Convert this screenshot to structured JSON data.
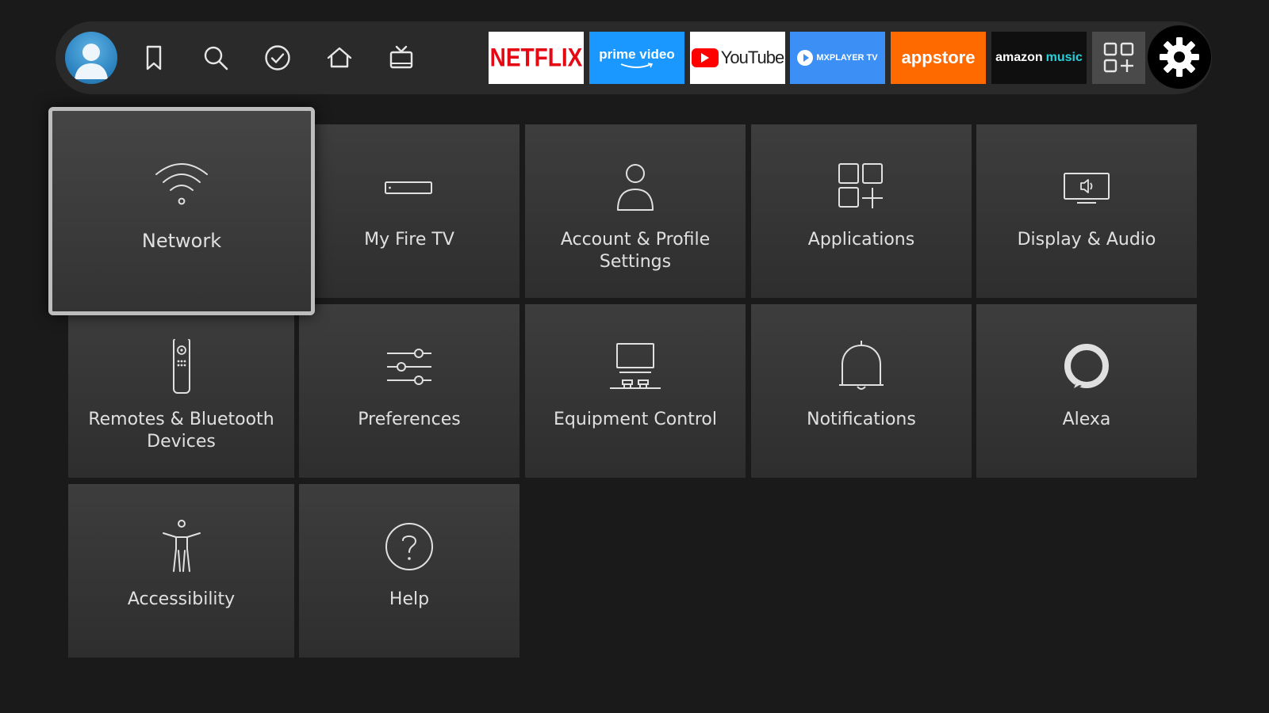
{
  "navbar": {
    "apps": [
      {
        "id": "netflix",
        "label": "NETFLIX",
        "color": "#e50914"
      },
      {
        "id": "prime",
        "label": "prime video",
        "color": "#1a98ff"
      },
      {
        "id": "youtube",
        "label": "YouTube",
        "color": "#ff0000"
      },
      {
        "id": "mx",
        "label": "MXPLAYER TV",
        "color": "#3b8ff5"
      },
      {
        "id": "appstore",
        "label": "appstore",
        "color": "#ff6a00"
      },
      {
        "id": "music",
        "label_brand": "amazon",
        "label_product": "music",
        "color": "#25d1da"
      }
    ],
    "icons": [
      "profile-avatar",
      "bookmark-icon",
      "search-icon",
      "check-circle-icon",
      "home-icon",
      "live-tv-icon",
      "all-apps-icon",
      "settings-gear-icon"
    ]
  },
  "settings": {
    "focused": "Network",
    "tiles": [
      {
        "label": "Network",
        "icon": "wifi-icon"
      },
      {
        "label": "My Fire TV",
        "icon": "fire-tv-device-icon"
      },
      {
        "label": "Account & Profile Settings",
        "icon": "person-icon"
      },
      {
        "label": "Applications",
        "icon": "apps-grid-icon"
      },
      {
        "label": "Display & Audio",
        "icon": "display-audio-icon"
      },
      {
        "label": "Remotes & Bluetooth Devices",
        "icon": "remote-icon"
      },
      {
        "label": "Preferences",
        "icon": "sliders-icon"
      },
      {
        "label": "Equipment Control",
        "icon": "equipment-icon"
      },
      {
        "label": "Notifications",
        "icon": "bell-icon"
      },
      {
        "label": "Alexa",
        "icon": "alexa-ring-icon"
      },
      {
        "label": "Accessibility",
        "icon": "accessibility-icon"
      },
      {
        "label": "Help",
        "icon": "help-icon"
      }
    ]
  },
  "colors": {
    "background": "#1a1a1a",
    "navbar": "#2a2a2a",
    "tile": "#3a3a3a",
    "focus_border": "#bdbdbd"
  }
}
